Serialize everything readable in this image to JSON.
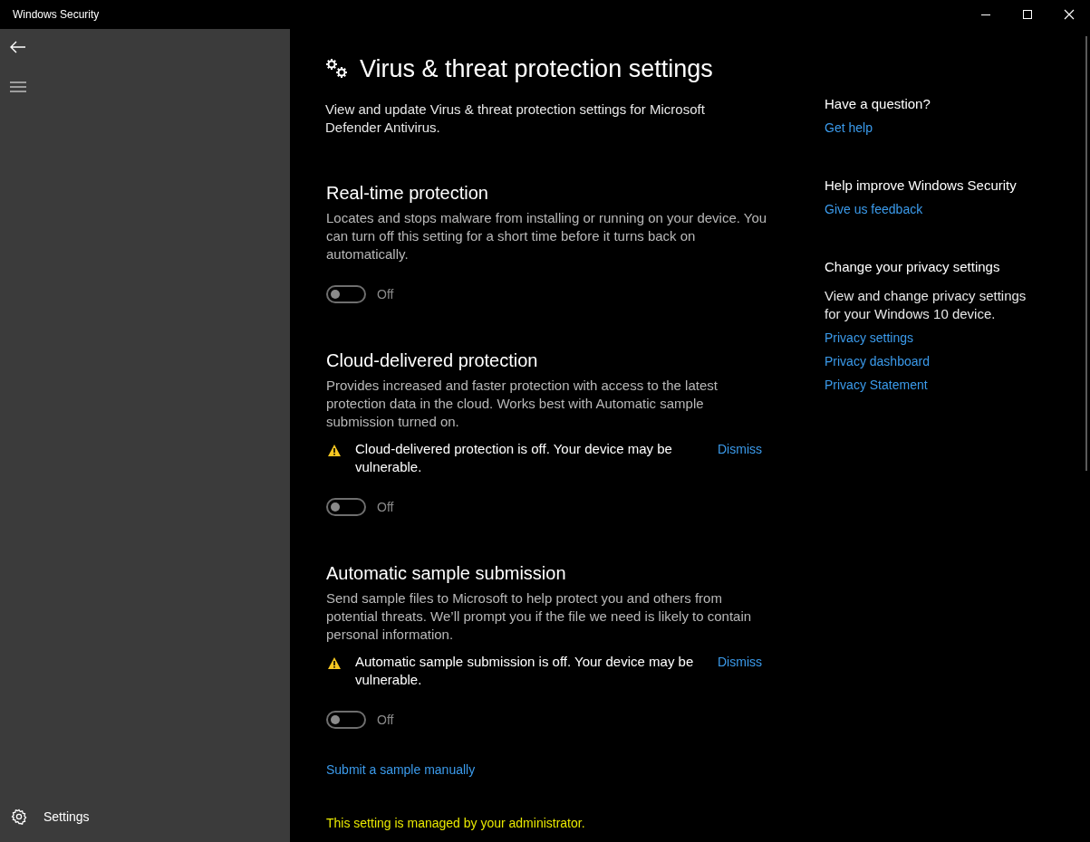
{
  "window": {
    "title": "Windows Security"
  },
  "sidebar": {
    "items": [
      {
        "label": "Settings"
      }
    ]
  },
  "page": {
    "title": "Virus & threat protection settings",
    "description": "View and update Virus & threat protection settings for Microsoft Defender Antivirus."
  },
  "sections": [
    {
      "title": "Real-time protection",
      "description": "Locates and stops malware from installing or running on your device. You can turn off this setting for a short time before it turns back on automatically.",
      "on": false,
      "state_label": "Off"
    },
    {
      "title": "Cloud-delivered protection",
      "description": "Provides increased and faster protection with access to the latest protection data in the cloud. Works best with Automatic sample submission turned on.",
      "warning": {
        "text": "Cloud-delivered protection is off. Your device may be vulnerable.",
        "action": "Dismiss"
      },
      "on": false,
      "state_label": "Off"
    },
    {
      "title": "Automatic sample submission",
      "description": "Send sample files to Microsoft to help protect you and others from potential threats. We’ll prompt you if the file we need is likely to contain personal information.",
      "warning": {
        "text": "Automatic sample submission is off. Your device may be vulnerable.",
        "action": "Dismiss"
      },
      "on": false,
      "state_label": "Off",
      "link": "Submit a sample manually"
    }
  ],
  "admin_note": "This setting is managed by your administrator.",
  "aside": [
    {
      "heading": "Have a question?",
      "links": [
        "Get help"
      ]
    },
    {
      "heading": "Help improve Windows Security",
      "links": [
        "Give us feedback"
      ]
    },
    {
      "heading": "Change your privacy settings",
      "description": "View and change privacy settings for your Windows 10 device.",
      "links": [
        "Privacy settings",
        "Privacy dashboard",
        "Privacy Statement"
      ]
    }
  ]
}
